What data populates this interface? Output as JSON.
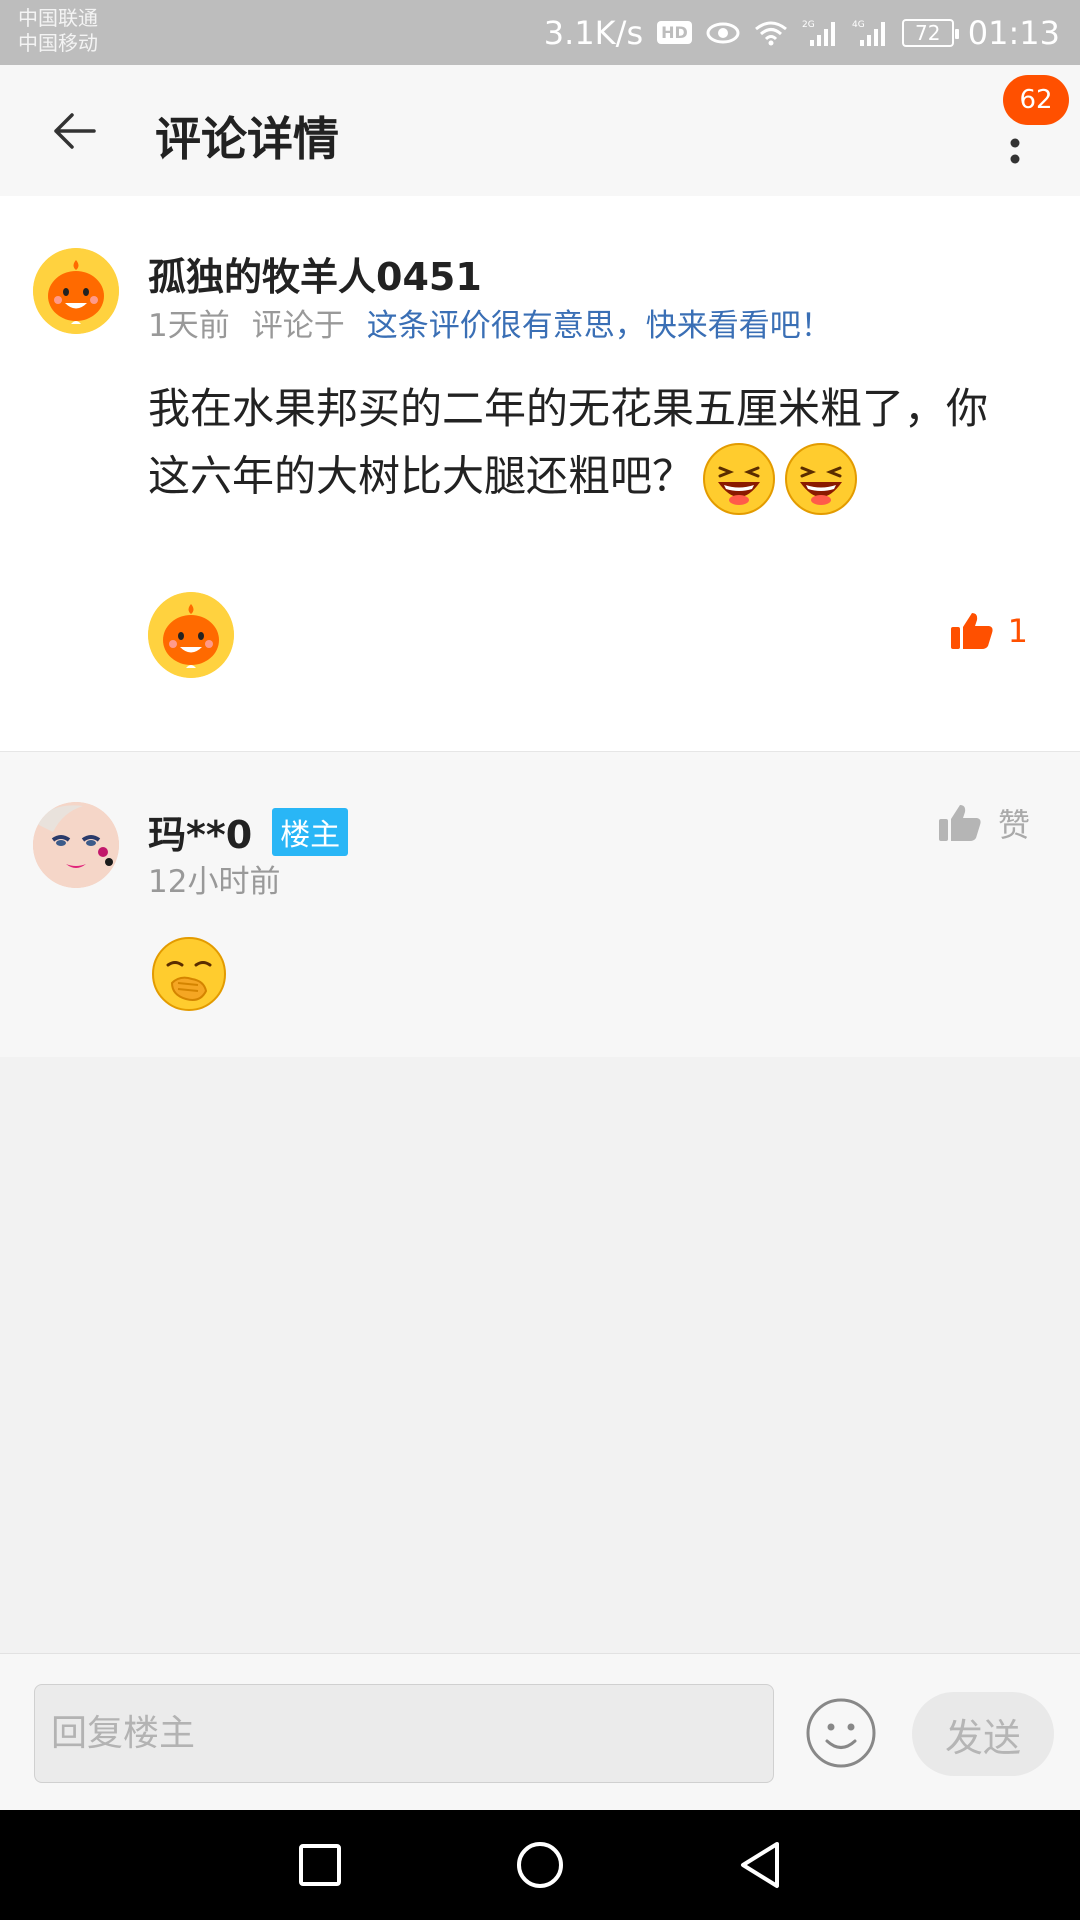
{
  "status_bar": {
    "carrier_1": "中国联通",
    "carrier_2": "中国移动",
    "net_speed": "3.1K/s",
    "hd": "HD",
    "signal_1_type": "2G",
    "signal_2_type": "4G",
    "battery": "72",
    "time": "01:13"
  },
  "header": {
    "title": "评论详情",
    "notification_count": "62"
  },
  "comment": {
    "username": "孤独的牧羊人0451",
    "time": "1天前",
    "commented_on_label": "评论于",
    "commented_on_link": "这条评价很有意思，快来看看吧！",
    "text": "我在水果邦买的二年的无花果五厘米粗了，你这六年的大树比大腿还粗吧？",
    "emojis": [
      "laughing-emoji",
      "laughing-emoji"
    ],
    "like_count": "1"
  },
  "reply": {
    "username": "玛**0",
    "badge": "楼主",
    "time": "12小时前",
    "like_label": "赞",
    "emoji": "yawning-emoji"
  },
  "input_bar": {
    "placeholder": "回复楼主",
    "send_label": "发送"
  },
  "colors": {
    "accent": "#ff5000",
    "link": "#3a6fb5",
    "owner_badge": "#29b6f6"
  }
}
